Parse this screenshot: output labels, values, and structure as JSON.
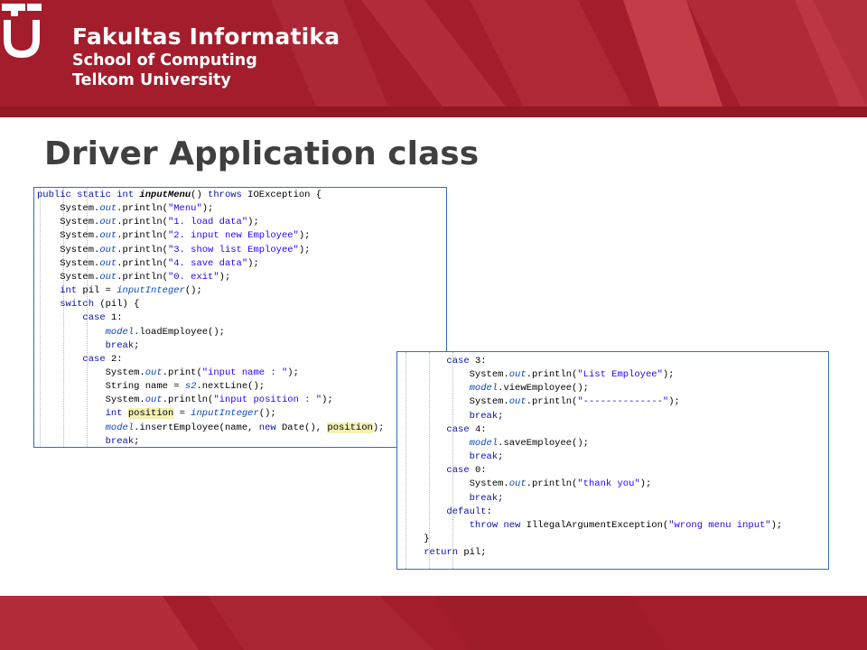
{
  "header": {
    "faculty": "Fakultas Informatika",
    "school": "School of Computing",
    "university": "Telkom University"
  },
  "slide": {
    "title": "Driver Application class"
  },
  "colors": {
    "brand_red": "#a41d2c",
    "title_gray": "#3f3f3f",
    "panel_border": "#2f6fb5",
    "highlight": "#f4f1b4"
  },
  "code_panel_1": {
    "lines": [
      [
        {
          "t": "public static int ",
          "c": "kw"
        },
        {
          "t": "inputMenu",
          "c": "bold"
        },
        {
          "t": "() "
        },
        {
          "t": "throws",
          "c": "kw"
        },
        {
          "t": " IOException {"
        }
      ],
      [
        {
          "t": "    System."
        },
        {
          "t": "out",
          "c": "ital"
        },
        {
          "t": ".println("
        },
        {
          "t": "\"Menu\"",
          "c": "str"
        },
        {
          "t": ");"
        }
      ],
      [
        {
          "t": "    System."
        },
        {
          "t": "out",
          "c": "ital"
        },
        {
          "t": ".println("
        },
        {
          "t": "\"1. load data\"",
          "c": "str"
        },
        {
          "t": ");"
        }
      ],
      [
        {
          "t": "    System."
        },
        {
          "t": "out",
          "c": "ital"
        },
        {
          "t": ".println("
        },
        {
          "t": "\"2. input new Employee\"",
          "c": "str"
        },
        {
          "t": ");"
        }
      ],
      [
        {
          "t": "    System."
        },
        {
          "t": "out",
          "c": "ital"
        },
        {
          "t": ".println("
        },
        {
          "t": "\"3. show list Employee\"",
          "c": "str"
        },
        {
          "t": ");"
        }
      ],
      [
        {
          "t": "    System."
        },
        {
          "t": "out",
          "c": "ital"
        },
        {
          "t": ".println("
        },
        {
          "t": "\"4. save data\"",
          "c": "str"
        },
        {
          "t": ");"
        }
      ],
      [
        {
          "t": "    System."
        },
        {
          "t": "out",
          "c": "ital"
        },
        {
          "t": ".println("
        },
        {
          "t": "\"0. exit\"",
          "c": "str"
        },
        {
          "t": ");"
        }
      ],
      [
        {
          "t": "    "
        },
        {
          "t": "int",
          "c": "kw"
        },
        {
          "t": " pil = "
        },
        {
          "t": "inputInteger",
          "c": "ital"
        },
        {
          "t": "();"
        }
      ],
      [
        {
          "t": "    "
        },
        {
          "t": "switch",
          "c": "kw"
        },
        {
          "t": " (pil) {"
        }
      ],
      [
        {
          "t": "        "
        },
        {
          "t": "case",
          "c": "kw"
        },
        {
          "t": " 1:"
        }
      ],
      [
        {
          "t": "            "
        },
        {
          "t": "model",
          "c": "ital"
        },
        {
          "t": ".loadEmployee();"
        }
      ],
      [
        {
          "t": "            "
        },
        {
          "t": "break",
          "c": "kw"
        },
        {
          "t": ";"
        }
      ],
      [
        {
          "t": "        "
        },
        {
          "t": "case",
          "c": "kw"
        },
        {
          "t": " 2:"
        }
      ],
      [
        {
          "t": "            System."
        },
        {
          "t": "out",
          "c": "ital"
        },
        {
          "t": ".print("
        },
        {
          "t": "\"input name : \"",
          "c": "str"
        },
        {
          "t": ");"
        }
      ],
      [
        {
          "t": "            String name = "
        },
        {
          "t": "s2",
          "c": "ital"
        },
        {
          "t": ".nextLine();"
        }
      ],
      [
        {
          "t": "            System."
        },
        {
          "t": "out",
          "c": "ital"
        },
        {
          "t": ".println("
        },
        {
          "t": "\"input position : \"",
          "c": "str"
        },
        {
          "t": ");"
        }
      ],
      [
        {
          "t": "            "
        },
        {
          "t": "int",
          "c": "kw"
        },
        {
          "t": " "
        },
        {
          "t": "position",
          "c": "hl"
        },
        {
          "t": " = "
        },
        {
          "t": "inputInteger",
          "c": "ital"
        },
        {
          "t": "();"
        }
      ],
      [
        {
          "t": "            "
        },
        {
          "t": "model",
          "c": "ital"
        },
        {
          "t": ".insertEmployee(name, "
        },
        {
          "t": "new",
          "c": "kw"
        },
        {
          "t": " Date(), "
        },
        {
          "t": "position",
          "c": "hl"
        },
        {
          "t": ");"
        }
      ],
      [
        {
          "t": "            "
        },
        {
          "t": "break",
          "c": "kw"
        },
        {
          "t": ";"
        }
      ]
    ]
  },
  "code_panel_2": {
    "lines": [
      [
        {
          "t": "        "
        },
        {
          "t": "case",
          "c": "kw"
        },
        {
          "t": " 3:"
        }
      ],
      [
        {
          "t": "            System."
        },
        {
          "t": "out",
          "c": "ital"
        },
        {
          "t": ".println("
        },
        {
          "t": "\"List Employee\"",
          "c": "str"
        },
        {
          "t": ");"
        }
      ],
      [
        {
          "t": "            "
        },
        {
          "t": "model",
          "c": "ital"
        },
        {
          "t": ".viewEmployee();"
        }
      ],
      [
        {
          "t": "            System."
        },
        {
          "t": "out",
          "c": "ital"
        },
        {
          "t": ".println("
        },
        {
          "t": "\"--------------\"",
          "c": "str"
        },
        {
          "t": ");"
        }
      ],
      [
        {
          "t": "            "
        },
        {
          "t": "break",
          "c": "kw"
        },
        {
          "t": ";"
        }
      ],
      [
        {
          "t": "        "
        },
        {
          "t": "case",
          "c": "kw"
        },
        {
          "t": " 4:"
        }
      ],
      [
        {
          "t": "            "
        },
        {
          "t": "model",
          "c": "ital"
        },
        {
          "t": ".saveEmployee();"
        }
      ],
      [
        {
          "t": "            "
        },
        {
          "t": "break",
          "c": "kw"
        },
        {
          "t": ";"
        }
      ],
      [
        {
          "t": "        "
        },
        {
          "t": "case",
          "c": "kw"
        },
        {
          "t": " 0:"
        }
      ],
      [
        {
          "t": "            System."
        },
        {
          "t": "out",
          "c": "ital"
        },
        {
          "t": ".println("
        },
        {
          "t": "\"thank you\"",
          "c": "str"
        },
        {
          "t": ");"
        }
      ],
      [
        {
          "t": "            "
        },
        {
          "t": "break",
          "c": "kw"
        },
        {
          "t": ";"
        }
      ],
      [
        {
          "t": "        "
        },
        {
          "t": "default",
          "c": "kw"
        },
        {
          "t": ":"
        }
      ],
      [
        {
          "t": "            "
        },
        {
          "t": "throw",
          "c": "kw"
        },
        {
          "t": " "
        },
        {
          "t": "new",
          "c": "kw"
        },
        {
          "t": " IllegalArgumentException("
        },
        {
          "t": "\"wrong menu input\"",
          "c": "str"
        },
        {
          "t": ");"
        }
      ],
      [
        {
          "t": "    }"
        }
      ],
      [
        {
          "t": "    "
        },
        {
          "t": "return",
          "c": "kw"
        },
        {
          "t": " pil;"
        }
      ]
    ]
  }
}
